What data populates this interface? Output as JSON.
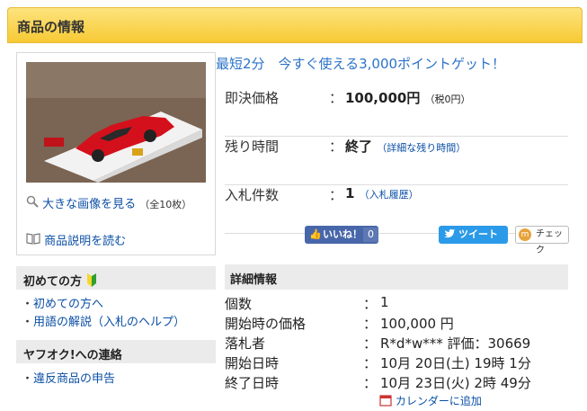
{
  "header": {
    "title": "商品の情報"
  },
  "image_panel": {
    "enlarge_link": "大きな画像を見る",
    "image_count": "（全10枚）",
    "description_link": "商品説明を読む"
  },
  "promo": "最短2分　今すぐ使える3,000ポイントゲット！",
  "summary": {
    "price": {
      "label": "即決価格",
      "value": "100,000円",
      "sub": "（税0円）"
    },
    "time_left": {
      "label": "残り時間",
      "value": "終了",
      "sub": "（詳細な残り時間）"
    },
    "bids": {
      "label": "入札件数",
      "value": "1",
      "sub": "（入札履歴）"
    },
    "colon": "："
  },
  "share": {
    "like_label": "いいね！",
    "like_count": "0",
    "tweet_label": "ツイート",
    "check_label": "チェック"
  },
  "sidebar": {
    "beginner_title": "初めての方",
    "beginner_items": [
      "初めての方へ",
      "用語の解説（入札のヘルプ）"
    ],
    "contact_title": "ヤフオク!への連絡",
    "contact_items": [
      "違反商品の申告"
    ],
    "bullet": "・"
  },
  "details": {
    "title": "詳細情報",
    "colon": "：",
    "rows": [
      {
        "label": "個数",
        "value": "1"
      },
      {
        "label": "開始時の価格",
        "value": "100,000 円"
      },
      {
        "label": "落札者",
        "value": "R*d*w*** 評価：30669"
      },
      {
        "label": "開始日時",
        "value": "10月 20日(土) 19時 1分"
      },
      {
        "label": "終了日時",
        "value": "10月 23日(火) 2時 49分"
      }
    ],
    "calendar_link": "カレンダーに追加"
  },
  "colors": {
    "header_bg": "#f7c934",
    "link": "#0b4fa6",
    "promo": "#2b73c8",
    "facebook": "#4867aa",
    "twitter": "#2b9ae8"
  },
  "icons": [
    "search-icon",
    "book-icon",
    "beginner-mark-icon",
    "calendar-icon",
    "facebook-thumb-icon",
    "twitter-bird-icon",
    "check-icon"
  ]
}
